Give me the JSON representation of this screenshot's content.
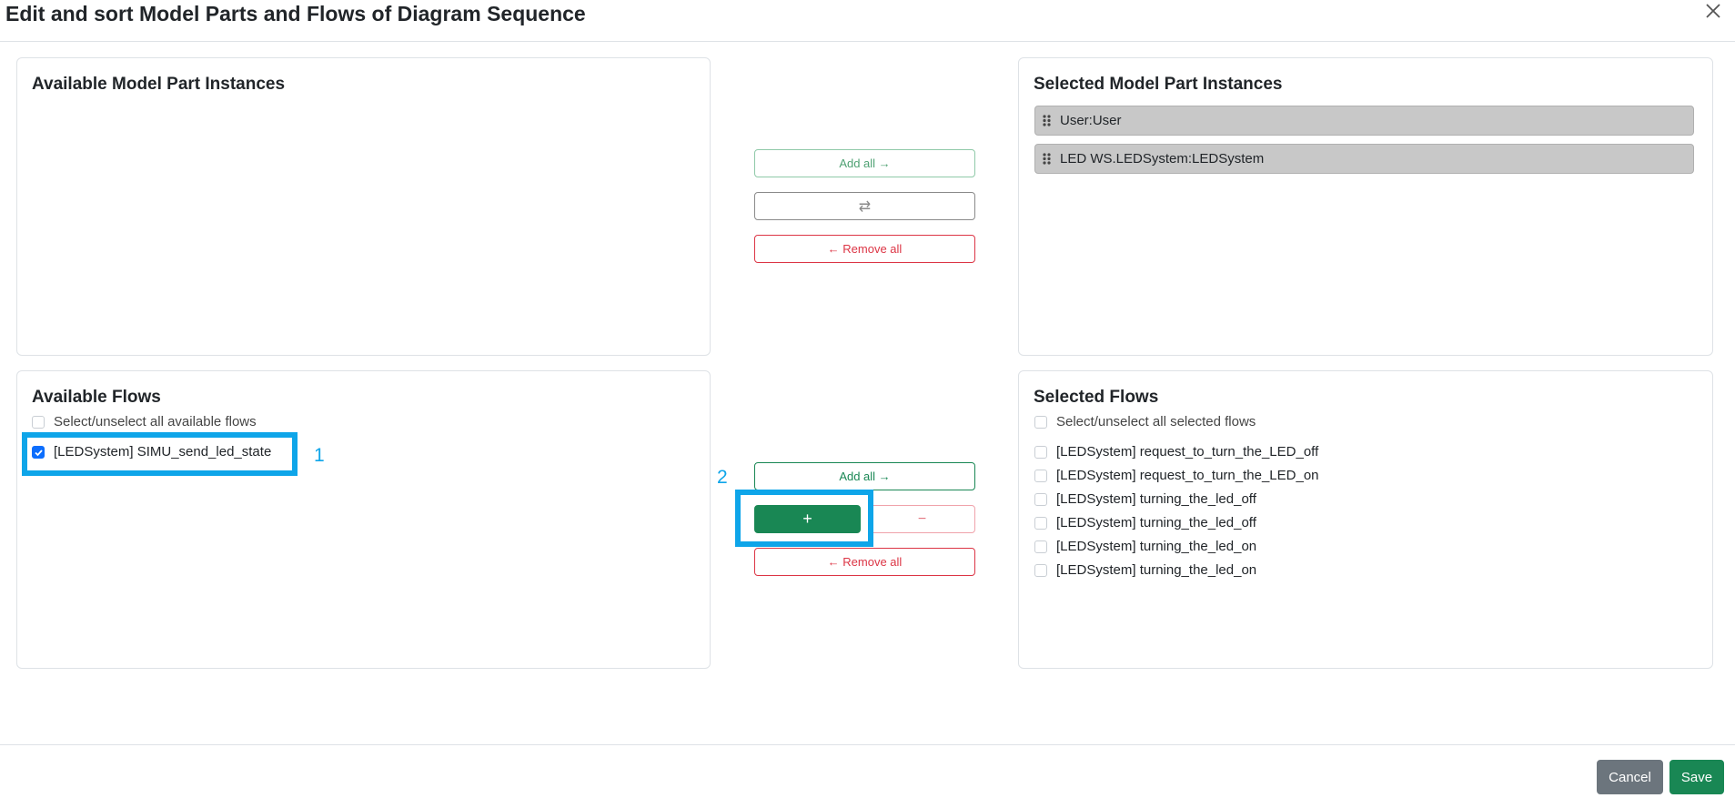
{
  "dialog": {
    "title": "Edit and sort Model Parts and Flows of Diagram Sequence",
    "close_icon": "close-icon"
  },
  "available_parts": {
    "title": "Available Model Part Instances"
  },
  "selected_parts": {
    "title": "Selected Model Part Instances",
    "items": [
      "User:User",
      "LED WS.LEDSystem:LEDSystem"
    ]
  },
  "parts_controls": {
    "add_all": "Add all →",
    "swap": "⇄",
    "remove_all": "← Remove all"
  },
  "available_flows": {
    "title": "Available Flows",
    "select_all_label": "Select/unselect all available flows",
    "items": [
      {
        "label": "[LEDSystem] SIMU_send_led_state",
        "checked": true
      }
    ]
  },
  "selected_flows": {
    "title": "Selected Flows",
    "select_all_label": "Select/unselect all selected flows",
    "items": [
      "[LEDSystem] request_to_turn_the_LED_off",
      "[LEDSystem] request_to_turn_the_LED_on",
      "[LEDSystem] turning_the_led_off",
      "[LEDSystem] turning_the_led_off",
      "[LEDSystem] turning_the_led_on",
      "[LEDSystem] turning_the_led_on"
    ]
  },
  "flows_controls": {
    "add_all": "Add all →",
    "add_one": "+",
    "remove_one": "−",
    "remove_all": "← Remove all"
  },
  "annotations": {
    "step1": "1",
    "step2": "2",
    "highlight_color": "#0ea5e9"
  },
  "footer": {
    "cancel": "Cancel",
    "save": "Save"
  }
}
